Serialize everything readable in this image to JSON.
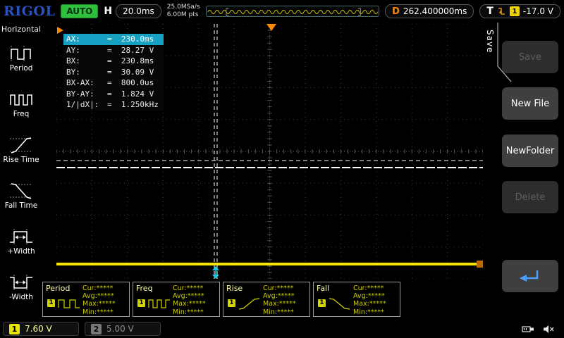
{
  "top_bar": {
    "logo": "RIGOL",
    "status": "AUTO",
    "horizontal": {
      "label": "H",
      "scale": "20.0ms"
    },
    "acquisition": {
      "sample_rate": "25.0MSa/s",
      "memory_depth": "6.00M pts"
    },
    "delay": {
      "label": "D",
      "value": "262.400000ms"
    },
    "trigger": {
      "label": "T",
      "source": "1",
      "level": "-17.0 V"
    }
  },
  "left_menu": {
    "title": "Horizontal",
    "items": [
      {
        "label": "Period"
      },
      {
        "label": "Freq"
      },
      {
        "label": "Rise Time"
      },
      {
        "label": "Fall Time"
      },
      {
        "label": "+Width"
      },
      {
        "label": "-Width"
      }
    ]
  },
  "cursor_readout": {
    "rows": [
      {
        "label": "AX:",
        "value": "=  230.0ms"
      },
      {
        "label": "AY:",
        "value": "=  28.27 V"
      },
      {
        "label": "BX:",
        "value": "=  230.8ms"
      },
      {
        "label": "BY:",
        "value": "=  30.09 V"
      },
      {
        "label": "BX-AX:",
        "value": "=  800.0us"
      },
      {
        "label": "BY-AY:",
        "value": "=  1.824 V"
      },
      {
        "label": "1/|dX|:",
        "value": "=  1.250kHz"
      }
    ]
  },
  "right_menu": {
    "tab": "Save",
    "buttons": [
      {
        "label": "Save",
        "enabled": false
      },
      {
        "label": "New File",
        "enabled": true
      },
      {
        "label": "NewFolder",
        "enabled": true
      },
      {
        "label": "Delete",
        "enabled": false
      }
    ],
    "back_button": {
      "icon": "return-arrow-icon"
    }
  },
  "measurements": [
    {
      "name": "Period",
      "channel": "1",
      "cur": "Cur:*****",
      "avg": "Avg:*****",
      "max": "Max:*****",
      "min": "Min:*****"
    },
    {
      "name": "Freq",
      "channel": "1",
      "cur": "Cur:*****",
      "avg": "Avg:*****",
      "max": "Max:*****",
      "min": "Min:*****"
    },
    {
      "name": "Rise",
      "channel": "1",
      "cur": "Cur:*****",
      "avg": "Avg:*****",
      "max": "Max:*****",
      "min": "Min:*****"
    },
    {
      "name": "Fall",
      "channel": "1",
      "cur": "Cur:*****",
      "avg": "Avg:*****",
      "max": "Max:*****",
      "min": "Min:*****"
    }
  ],
  "bottom_bar": {
    "channel1": {
      "number": "1",
      "scale": "7.60 V"
    },
    "channel2": {
      "number": "2",
      "scale": "5.00 V"
    }
  },
  "colors": {
    "channel1_yellow": "#f5e400",
    "cursor_highlight": "#17a2c4",
    "trigger_orange": "#ff8800",
    "auto_green": "#2fbf3f",
    "logo_blue": "#2a52be"
  }
}
